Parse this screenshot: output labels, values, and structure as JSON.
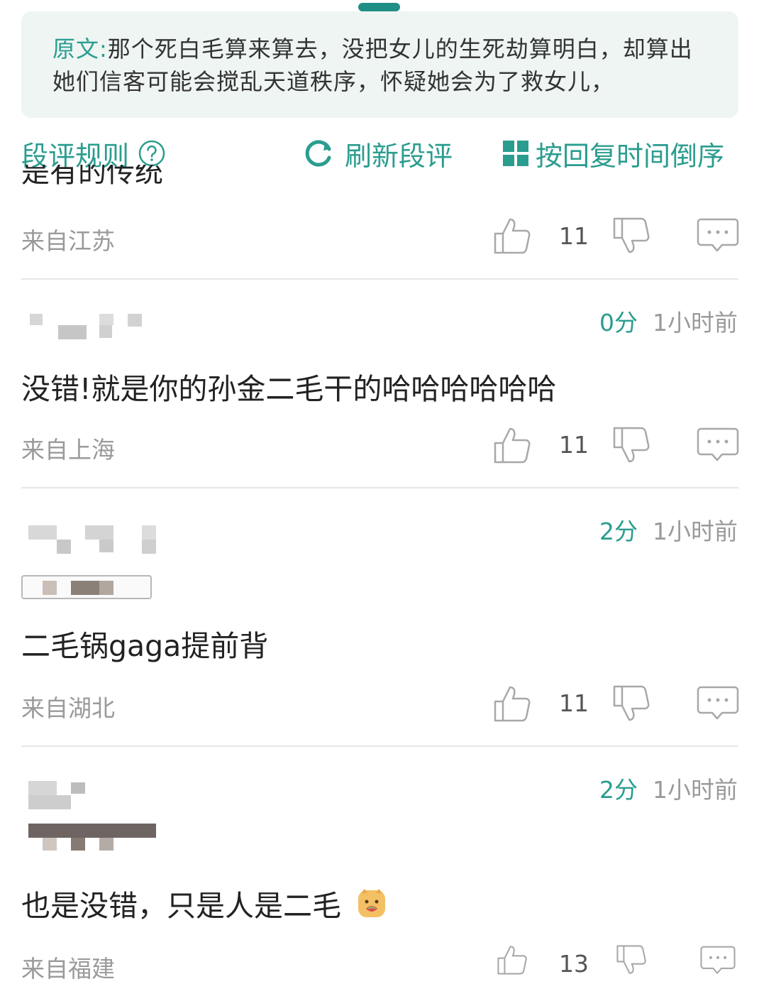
{
  "quote": {
    "label": "原文:",
    "text": "那个死白毛算来算去，没把女儿的生死劫算明白，却算出她们信客可能会搅乱天道秩序，怀疑她会为了救女儿，"
  },
  "toolbar": {
    "rules_label": "段评规则",
    "refresh_label": "刷新段评",
    "sort_label": "按回复时间倒序"
  },
  "partial_comment": {
    "peek_text": "是有的传统",
    "location": "来自江苏",
    "likes": "11"
  },
  "comments": [
    {
      "score": "0分",
      "time": "1小时前",
      "text": "没错!就是你的孙金二毛干的哈哈哈哈哈哈",
      "location": "来自上海",
      "likes": "11"
    },
    {
      "score": "2分",
      "time": "1小时前",
      "text": "二毛锅gaga提前背",
      "location": "来自湖北",
      "likes": "11"
    },
    {
      "score": "2分",
      "time": "1小时前",
      "text": "也是没错，只是人是二毛",
      "location": "来自福建",
      "likes": "13"
    }
  ],
  "colors": {
    "accent": "#2a9d8f",
    "muted": "#9a9a9a",
    "divider": "#e6e6e6",
    "quote_bg": "#eef5f3"
  },
  "icons": [
    "question-icon",
    "refresh-icon",
    "grid-icon",
    "thumbs-up-icon",
    "thumbs-down-icon",
    "reply-bubble-icon",
    "emoji-icon"
  ]
}
